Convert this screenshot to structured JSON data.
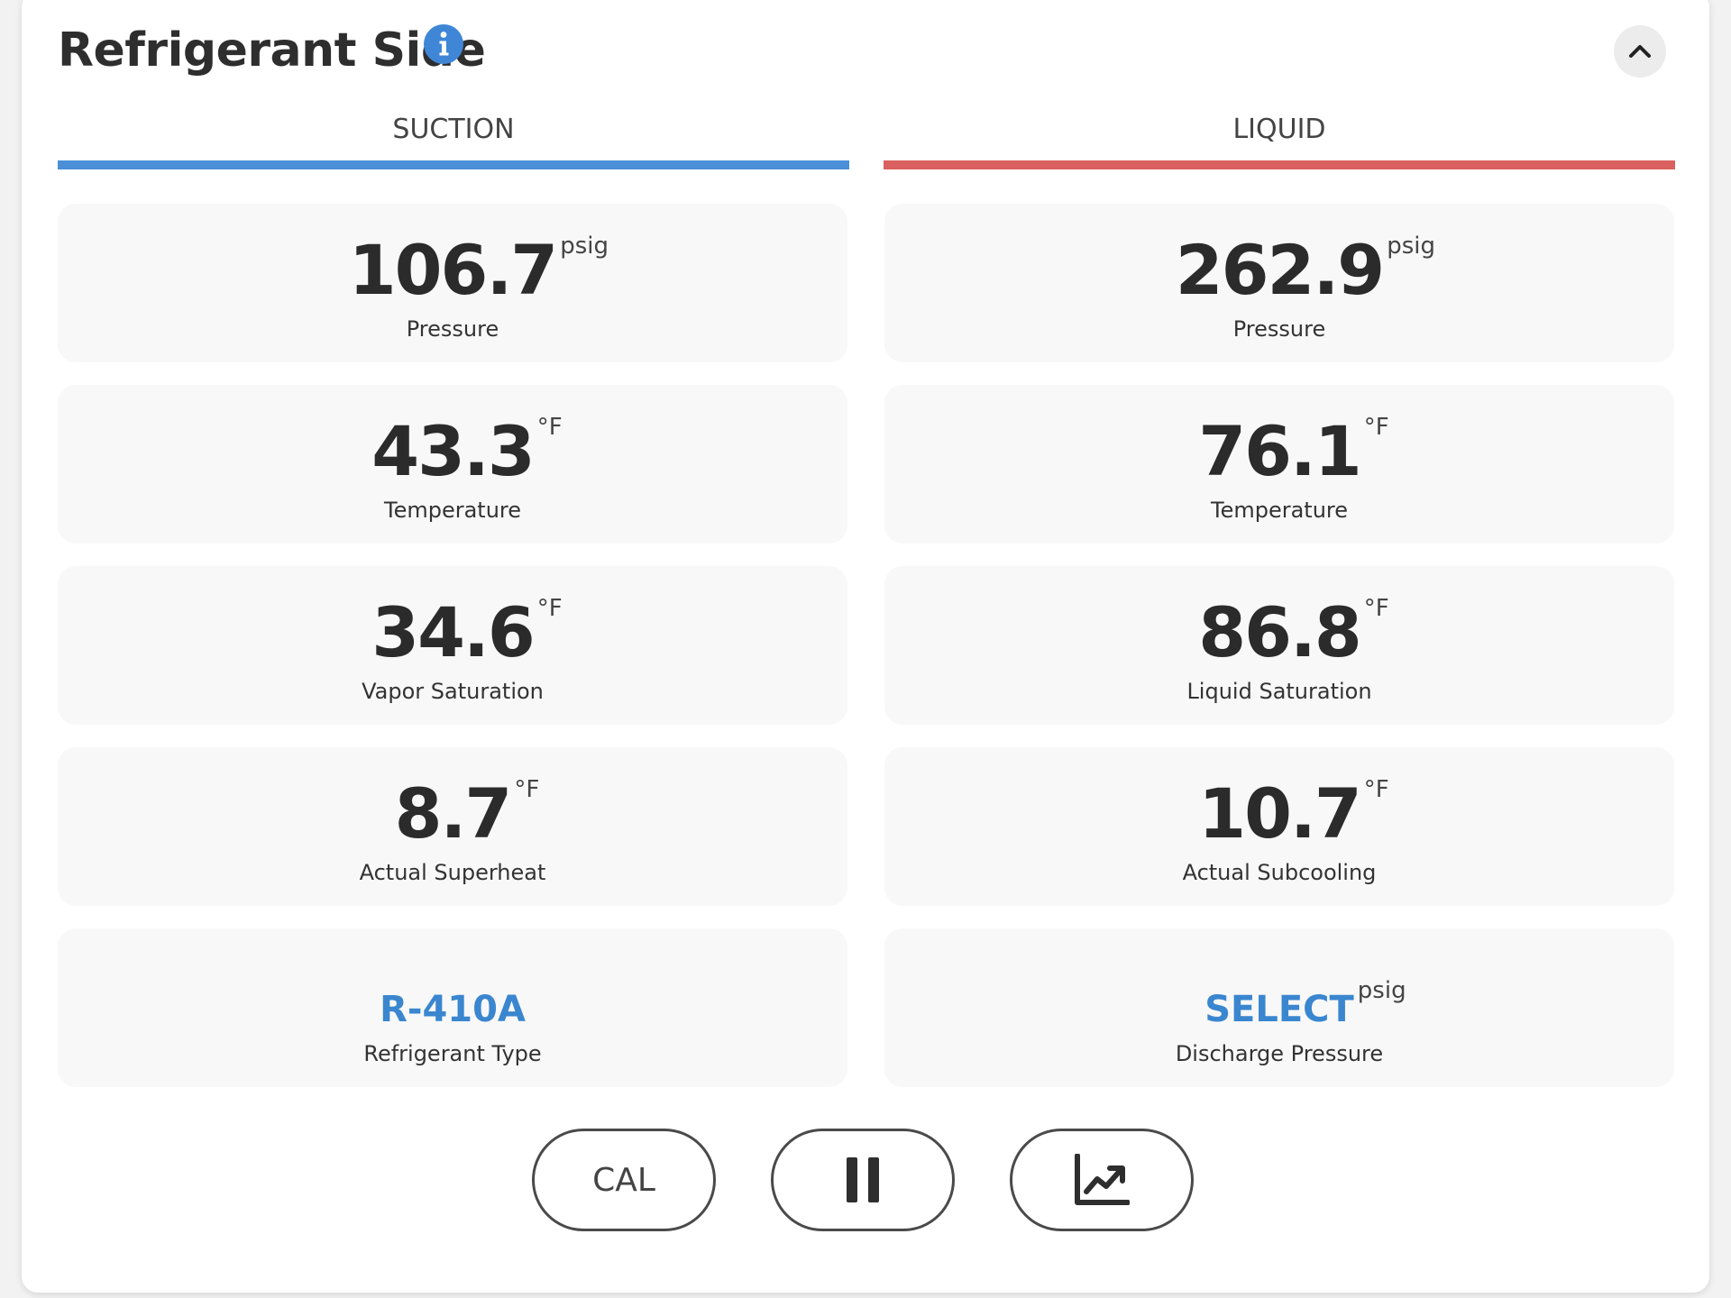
{
  "panel": {
    "title": "Refrigerant Side",
    "info_icon": "info-circle-icon",
    "collapse_icon": "chevron-up-icon"
  },
  "columns": {
    "suction": {
      "header": "SUCTION",
      "color": "#4a8fd8",
      "tiles": [
        {
          "value": "106.7",
          "unit": "psig",
          "label": "Pressure"
        },
        {
          "value": "43.3",
          "unit": "°F",
          "label": "Temperature"
        },
        {
          "value": "34.6",
          "unit": "°F",
          "label": "Vapor Saturation"
        },
        {
          "value": "8.7",
          "unit": "°F",
          "label": "Actual Superheat"
        },
        {
          "value": "R-410A",
          "unit": "",
          "label": "Refrigerant Type"
        }
      ]
    },
    "liquid": {
      "header": "LIQUID",
      "color": "#d9605e",
      "tiles": [
        {
          "value": "262.9",
          "unit": "psig",
          "label": "Pressure"
        },
        {
          "value": "76.1",
          "unit": "°F",
          "label": "Temperature"
        },
        {
          "value": "86.8",
          "unit": "°F",
          "label": "Liquid Saturation"
        },
        {
          "value": "10.7",
          "unit": "°F",
          "label": "Actual Subcooling"
        },
        {
          "value": "SELECT",
          "unit": "psig",
          "label": "Discharge Pressure"
        }
      ]
    }
  },
  "toolbar": {
    "cal_label": "CAL",
    "pause_icon": "pause-icon",
    "chart_icon": "trend-chart-icon"
  },
  "colors": {
    "link": "#3a86cf",
    "suction_bar": "#4a8fd8",
    "liquid_bar": "#d9605e",
    "info_icon": "#3f86d6"
  }
}
